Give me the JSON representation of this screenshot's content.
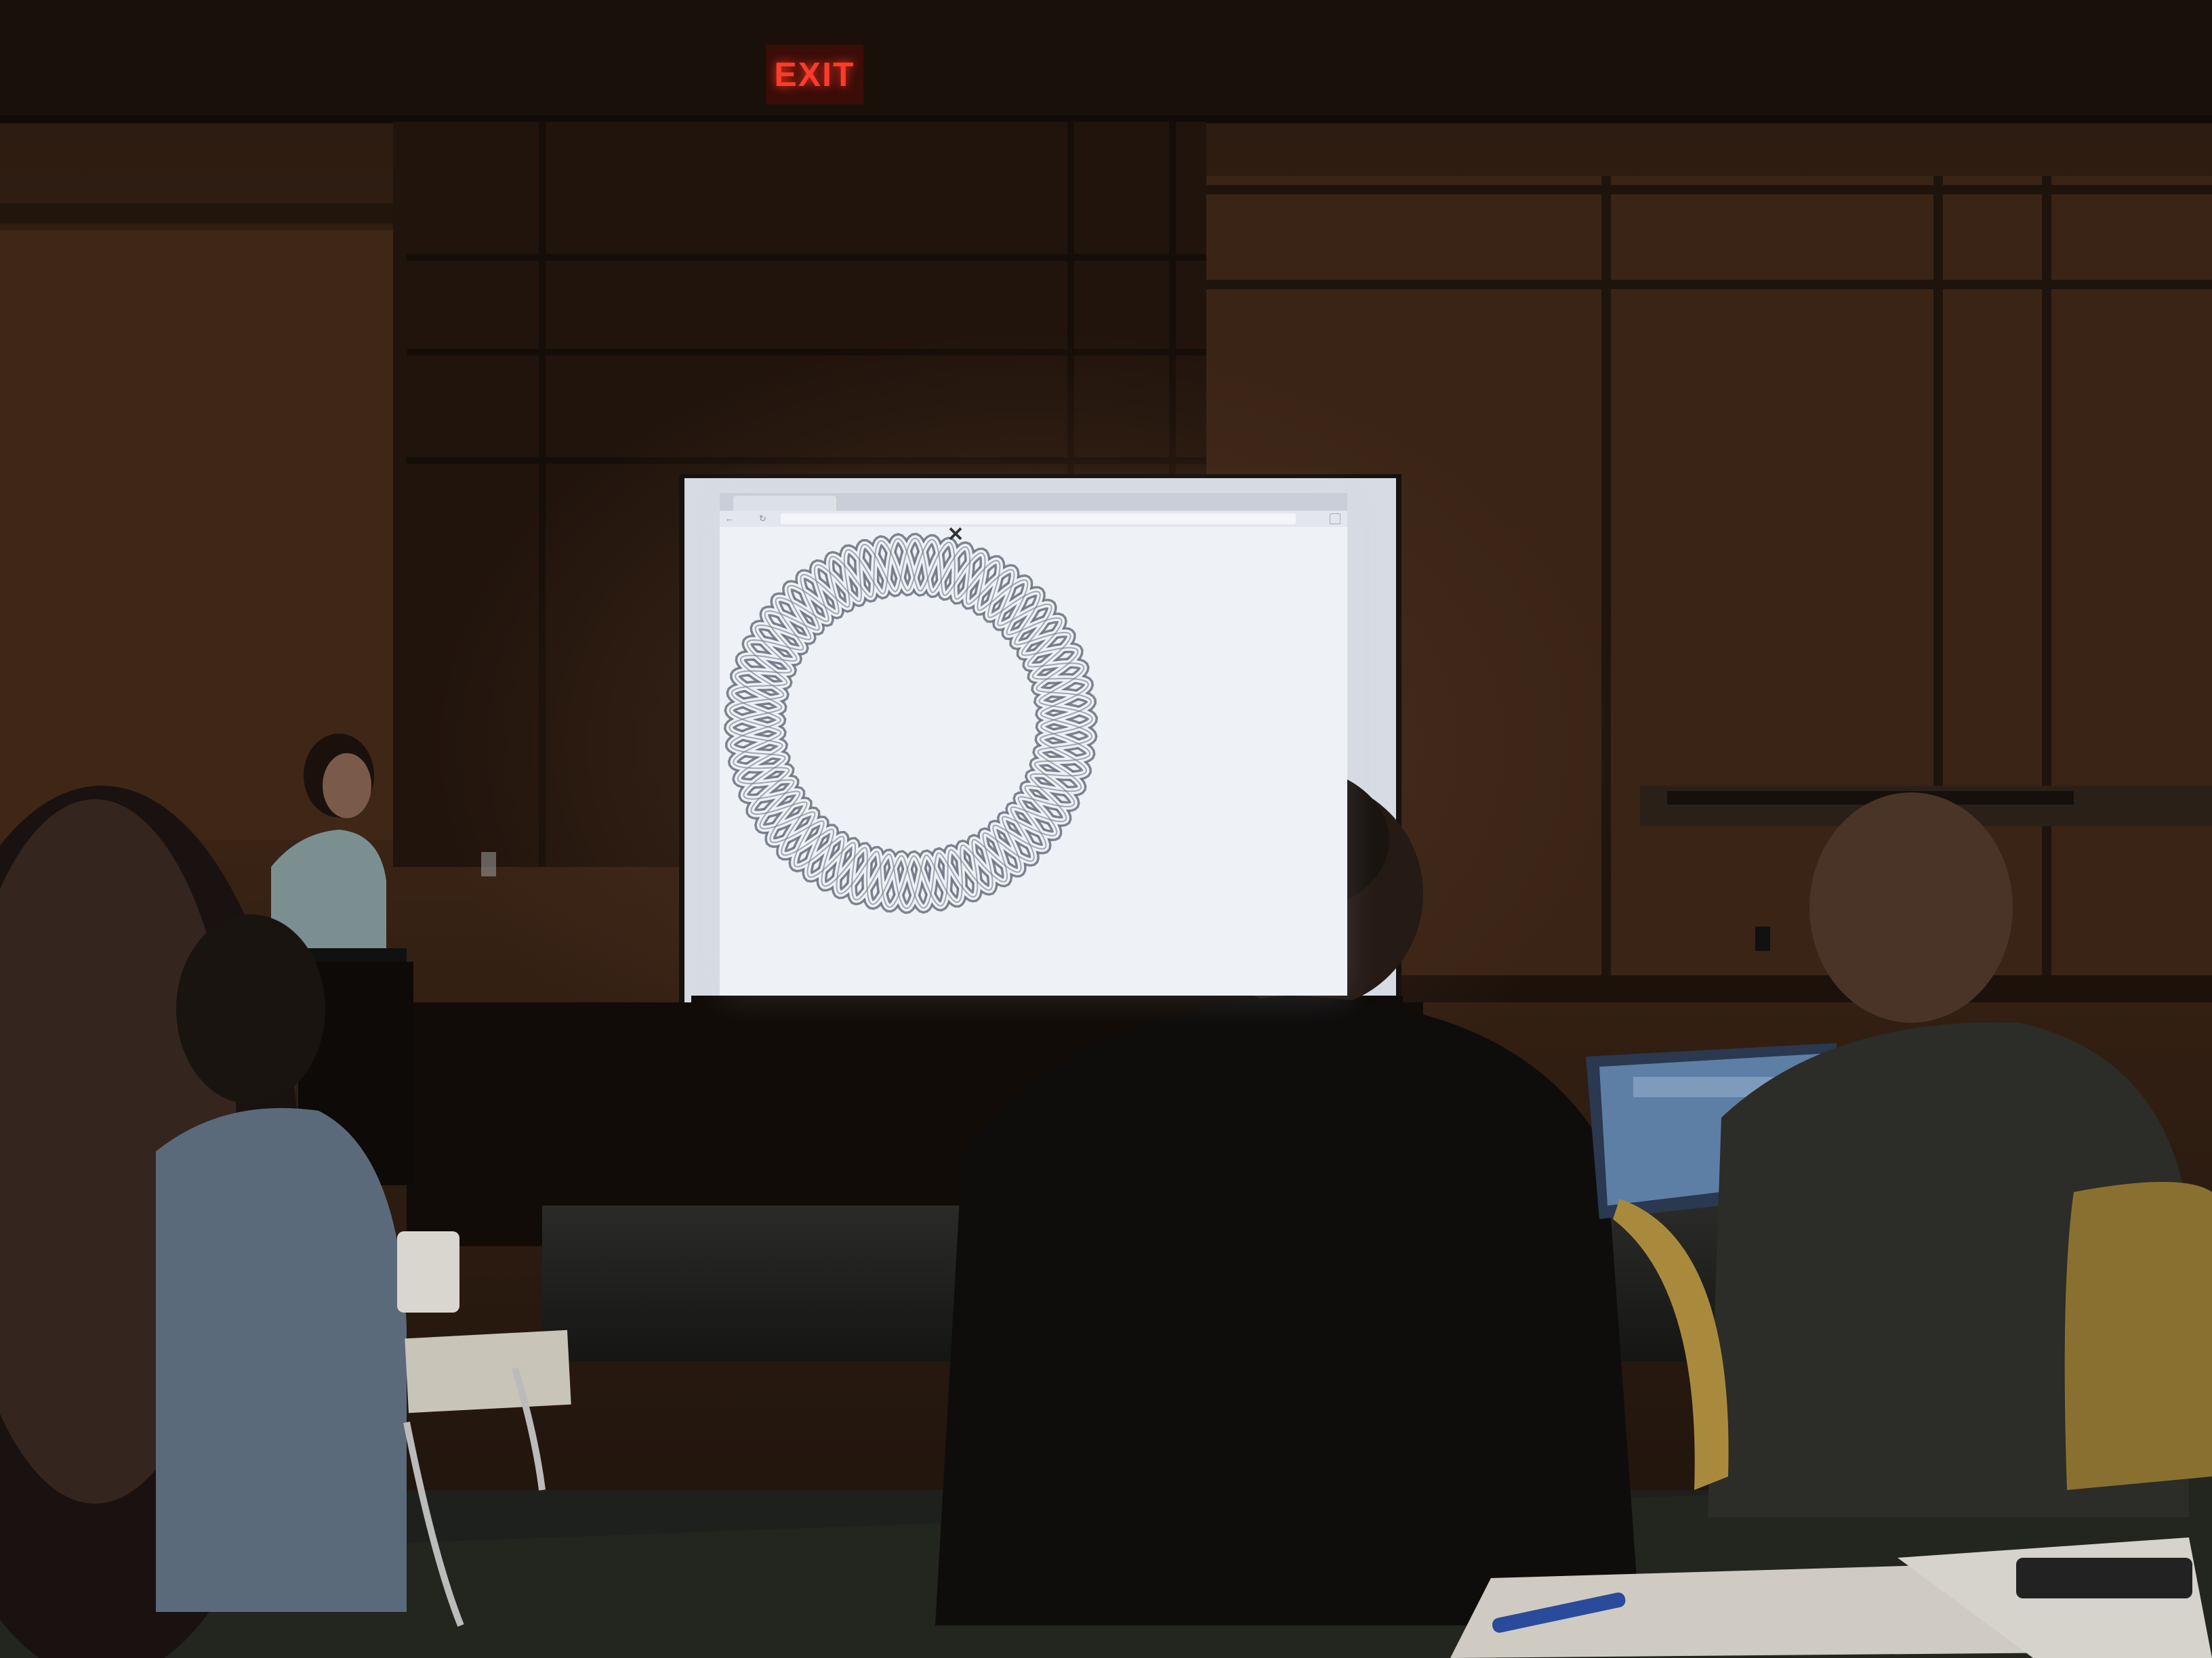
{
  "exit_sign": {
    "text": "EXIT",
    "color": "#ff3b2a"
  },
  "projection": {
    "browser": {
      "tab_label": "",
      "address": "",
      "icons": [
        "back-arrow-icon",
        "reload-icon",
        "menu-icon"
      ]
    },
    "content": "celtic-knot-ring",
    "knot_color": "#6f7784",
    "page_color": "#eef1f6"
  },
  "colors": {
    "wall": "#3a2316",
    "screen_glow": "#e7eaf0",
    "room_shadow": "#0c0806"
  }
}
